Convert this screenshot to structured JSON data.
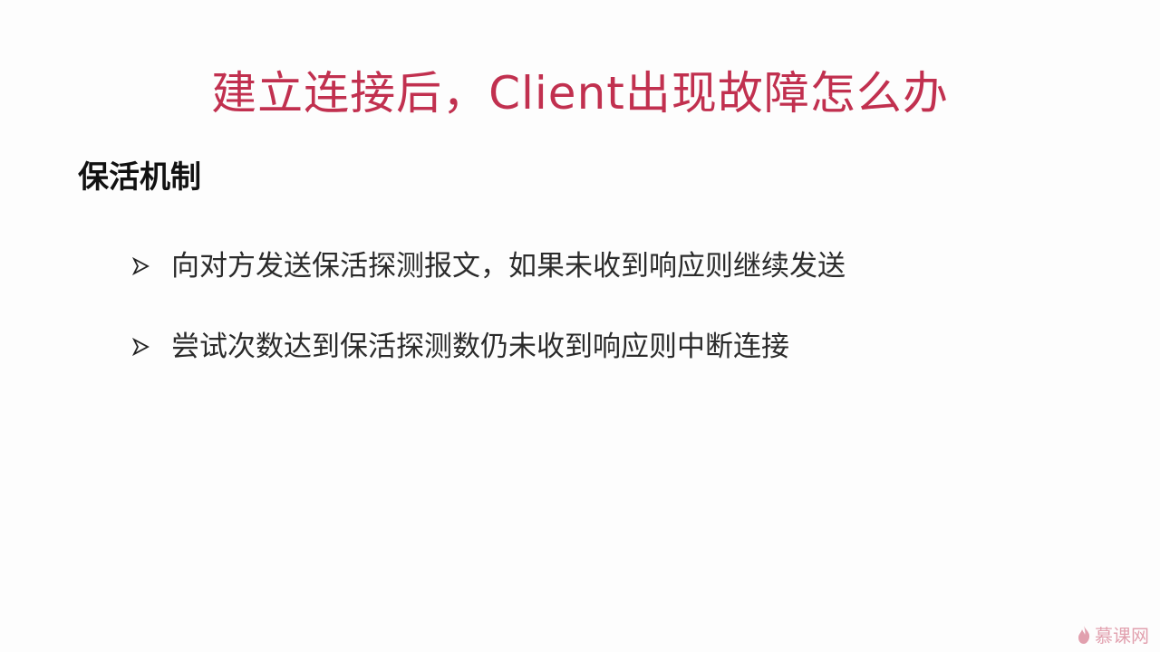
{
  "slide": {
    "title": "建立连接后，Client出现故障怎么办",
    "section_heading": "保活机制",
    "bullets": [
      {
        "icon": "arrow-bullet-icon",
        "text": "向对方发送保活探测报文，如果未收到响应则继续发送"
      },
      {
        "icon": "arrow-bullet-icon",
        "text": "尝试次数达到保活探测数仍未收到响应则中断连接"
      }
    ],
    "watermark": {
      "icon": "flame-logo-icon",
      "text": "慕课网"
    },
    "colors": {
      "title": "#c1304f",
      "heading": "#111111",
      "body_text": "#2b2b2b",
      "background": "#fdfdfd"
    }
  }
}
